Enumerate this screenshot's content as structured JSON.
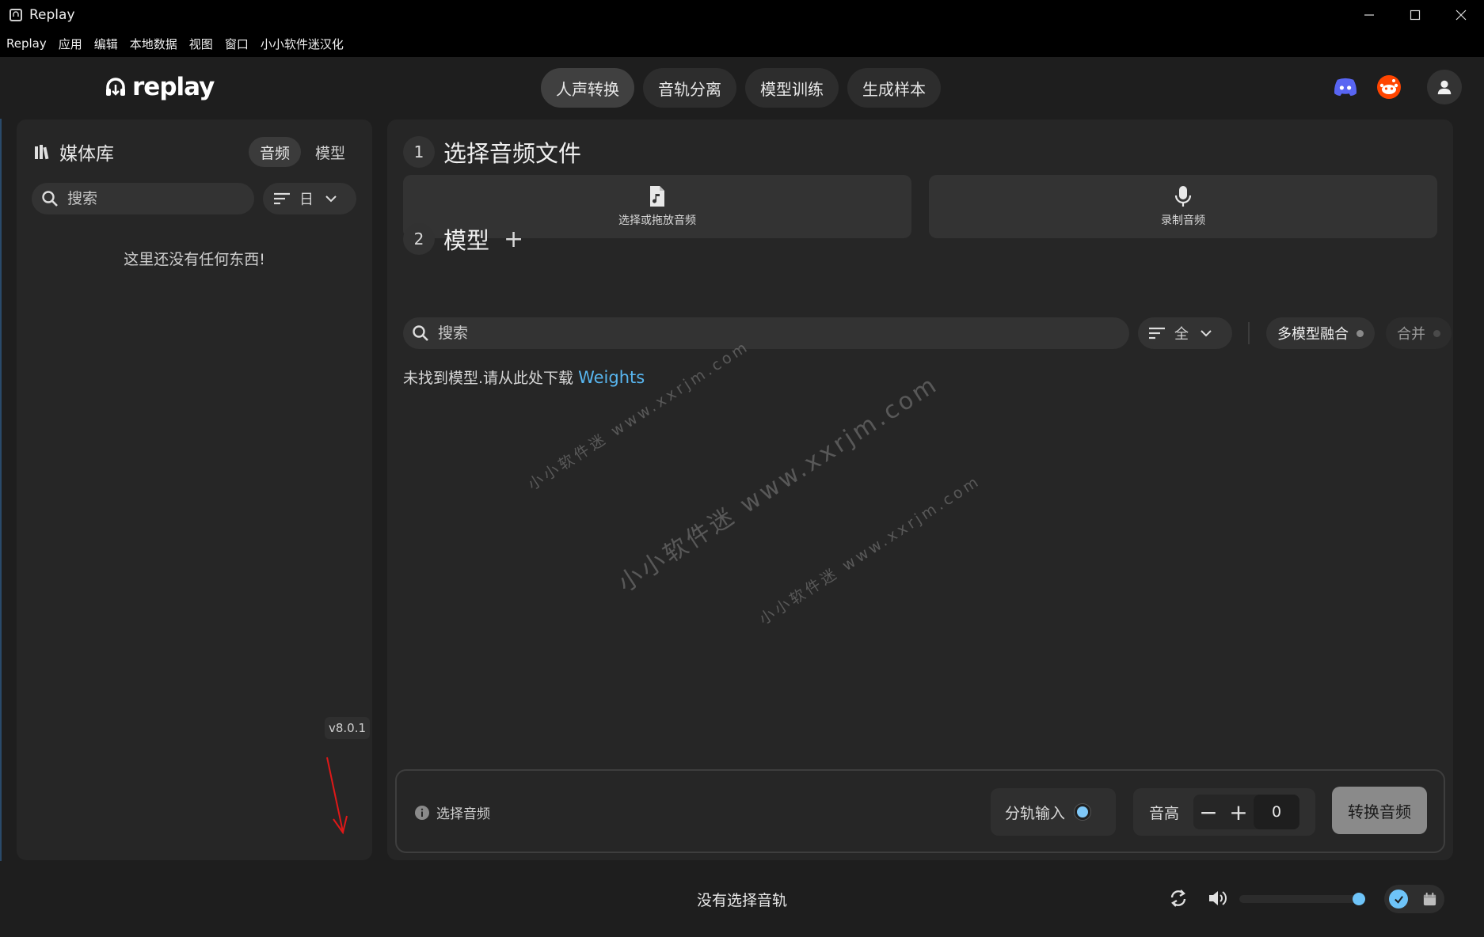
{
  "window": {
    "title": "Replay"
  },
  "menu": [
    "Replay",
    "应用",
    "编辑",
    "本地数据",
    "视图",
    "窗口",
    "小小软件迷汉化"
  ],
  "logo": {
    "text": "replay"
  },
  "nav": {
    "tabs": [
      {
        "label": "人声转换",
        "active": true
      },
      {
        "label": "音轨分离",
        "active": false
      },
      {
        "label": "模型训练",
        "active": false
      },
      {
        "label": "生成样本",
        "active": false
      }
    ]
  },
  "header_icons": [
    "discord-icon",
    "reddit-icon",
    "user-icon"
  ],
  "sidebar": {
    "title": "媒体库",
    "segments": [
      {
        "label": "音频",
        "active": true
      },
      {
        "label": "模型",
        "active": false
      }
    ],
    "search_placeholder": "搜索",
    "sort_value": "日",
    "empty_text": "这里还没有任何东西!",
    "version": "v8.0.1"
  },
  "main": {
    "step1": {
      "num": "1",
      "label": "选择音频文件"
    },
    "select_file_label": "选择或拖放音频",
    "record_label": "录制音频",
    "step2": {
      "num": "2",
      "label": "模型",
      "add": "+"
    },
    "search_placeholder": "搜索",
    "sort_value": "全",
    "chip_blend": "多模型融合",
    "chip_merge": "合并",
    "no_model_text": "未找到模型.请从此处下载",
    "no_model_link": "Weights"
  },
  "watermarks": [
    "小小软件迷  www.xxrjm.com",
    "小小软件迷  www.xxrjm.com",
    "小小软件迷  www.xxrjm.com"
  ],
  "convert_bar": {
    "info": "选择音频",
    "stem_input_label": "分轨输入",
    "pitch_label": "音高",
    "pitch_minus": "−",
    "pitch_plus": "+",
    "pitch_value": "0",
    "convert_button": "转换音频"
  },
  "footer": {
    "track_text": "没有选择音轨",
    "volume": 1.0
  },
  "colors": {
    "accent": "#6ec4f8",
    "link": "#58b6f0",
    "discord": "#5865f2",
    "reddit": "#ff4500"
  }
}
